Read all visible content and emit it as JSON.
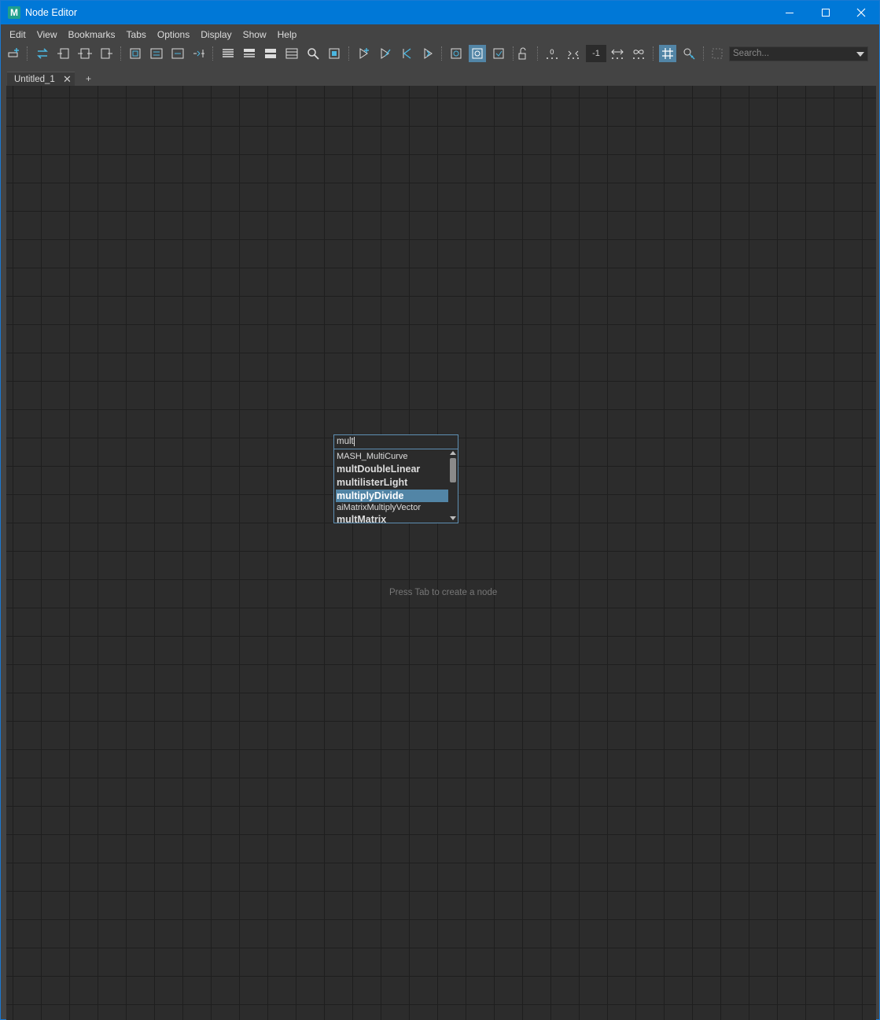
{
  "window": {
    "title": "Node Editor",
    "app_icon_letter": "M"
  },
  "menu": [
    "Edit",
    "View",
    "Bookmarks",
    "Tabs",
    "Options",
    "Display",
    "Show",
    "Help"
  ],
  "toolbar": {
    "number_field_value": "-1",
    "search_placeholder": "Search..."
  },
  "tabs": {
    "active_label": "Untitled_1",
    "close_glyph": "✕",
    "add_glyph": "+"
  },
  "canvas": {
    "hint": "Press Tab to create a node"
  },
  "node_popup": {
    "query": "mult",
    "items": [
      {
        "label": "MASH_MultiCurve",
        "style": "small",
        "selected": false
      },
      {
        "label": "multDoubleLinear",
        "style": "big",
        "selected": false
      },
      {
        "label": "multilisterLight",
        "style": "big",
        "selected": false
      },
      {
        "label": "multiplyDivide",
        "style": "big",
        "selected": true
      },
      {
        "label": "aiMatrixMultiplyVector",
        "style": "small",
        "selected": false
      },
      {
        "label": "multMatrix",
        "style": "big",
        "selected": false
      }
    ]
  },
  "colors": {
    "titlebar": "#0078d7",
    "selection": "#5285a6",
    "canvas_bg": "#2c2c2c",
    "toolbar_icon_blue": "#4bb6e0"
  }
}
